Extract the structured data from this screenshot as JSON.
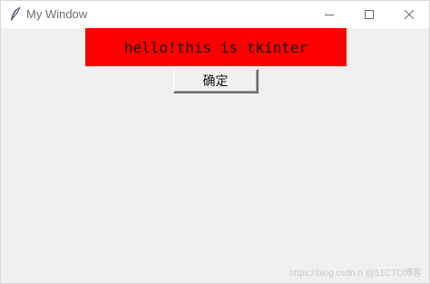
{
  "window": {
    "title": "My Window",
    "app_icon": "feather-icon",
    "controls": {
      "minimize": "minimize-icon",
      "maximize": "maximize-icon",
      "close": "close-icon"
    }
  },
  "main": {
    "label_text": "hello!this is tkinter",
    "label_bg": "#ff0000",
    "button_label": "确定"
  },
  "watermark": "https://blog.csdn.n @51CTO博客"
}
